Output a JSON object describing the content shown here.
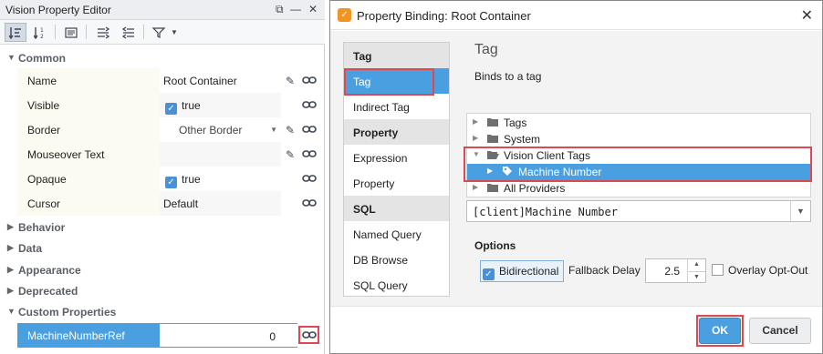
{
  "left_panel": {
    "title": "Vision Property Editor",
    "window_buttons": [
      "⧉",
      "—",
      "✕"
    ],
    "sections": {
      "common": "Common",
      "behavior": "Behavior",
      "data": "Data",
      "appearance": "Appearance",
      "deprecated": "Deprecated",
      "custom": "Custom Properties"
    },
    "props": {
      "name": {
        "label": "Name",
        "value": "Root Container"
      },
      "visible": {
        "label": "Visible",
        "value": "true"
      },
      "border": {
        "label": "Border",
        "value": "Other Border"
      },
      "mouseover": {
        "label": "Mouseover Text",
        "value": ""
      },
      "opaque": {
        "label": "Opaque",
        "value": "true"
      },
      "cursor": {
        "label": "Cursor",
        "value": "Default"
      },
      "machine": {
        "label": "MachineNumberRef",
        "value": "0"
      }
    }
  },
  "dialog": {
    "title": "Property Binding: Root Container",
    "logo": "✓",
    "types": {
      "tag_group": "Tag",
      "tag": "Tag",
      "indirect_tag": "Indirect Tag",
      "property_group": "Property",
      "expression": "Expression",
      "property": "Property",
      "sql_group": "SQL",
      "named_query": "Named Query",
      "db_browse": "DB Browse",
      "sql_query": "SQL Query"
    },
    "config": {
      "heading": "Tag",
      "description": "Binds to a tag",
      "tree": {
        "tags": "Tags",
        "system": "System",
        "vision_client_tags": "Vision Client Tags",
        "machine_number": "Machine Number",
        "all_providers": "All Providers"
      },
      "tag_path": "[client]Machine Number",
      "options_label": "Options",
      "bidirectional": "Bidirectional",
      "fallback_delay_label": "Fallback Delay",
      "fallback_delay": "2.5",
      "overlay_opt_out": "Overlay Opt-Out"
    },
    "buttons": {
      "ok": "OK",
      "cancel": "Cancel"
    }
  },
  "accent_color": "#4a9fe0",
  "highlight_color": "#e0484f"
}
